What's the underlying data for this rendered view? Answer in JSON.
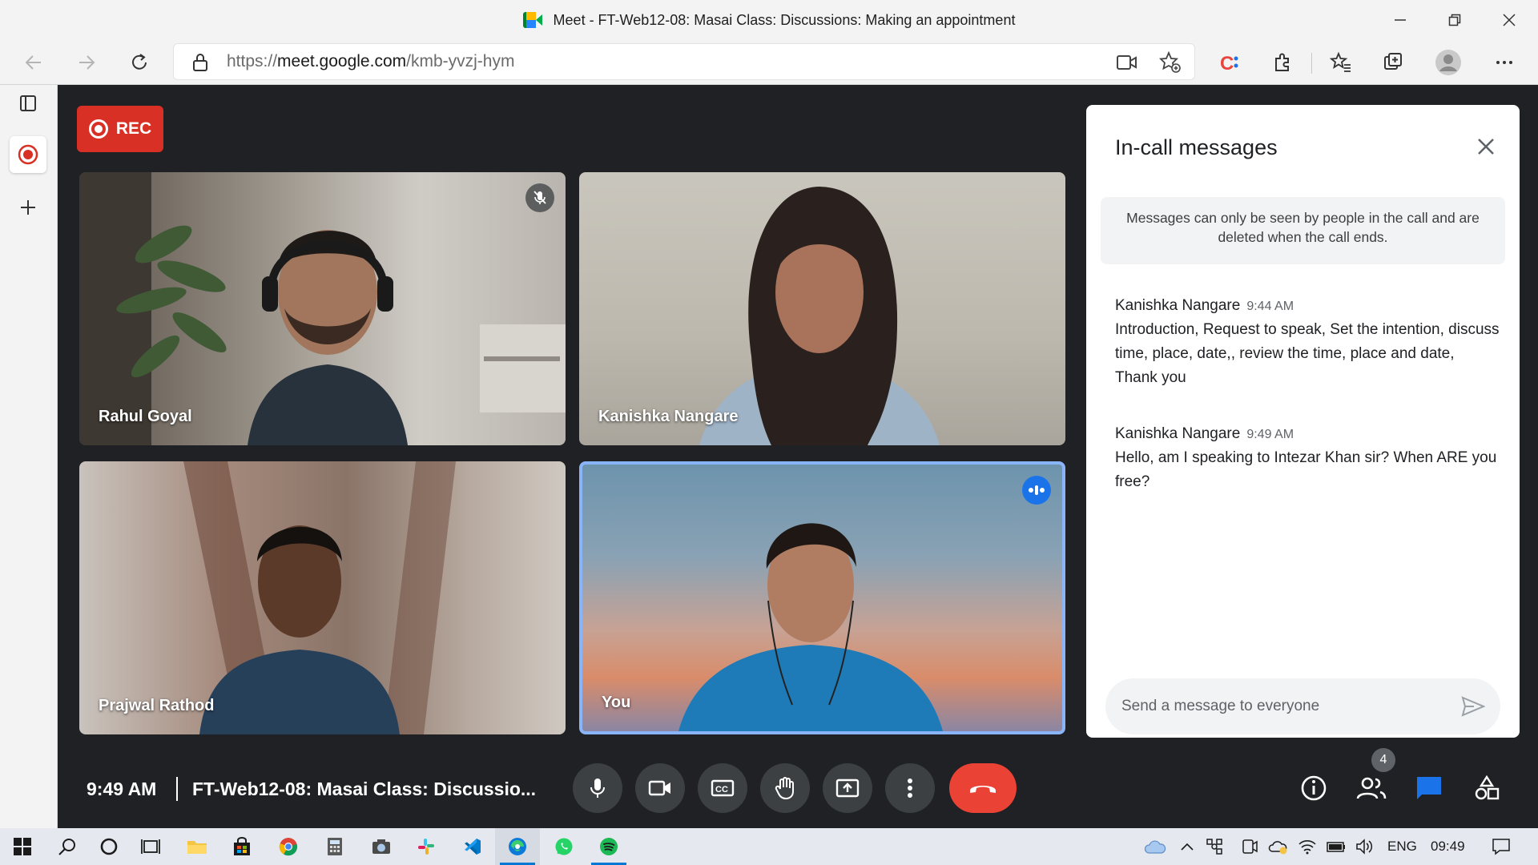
{
  "window": {
    "title": "Meet - FT-Web12-08: Masai Class: Discussions: Making an appointment"
  },
  "browser": {
    "url_prefix": "https://",
    "url_host": "meet.google.com",
    "url_path": "/kmb-yvzj-hym"
  },
  "recording": {
    "label": "REC"
  },
  "participants": [
    {
      "name": "Rahul Goyal",
      "muted": true
    },
    {
      "name": "Kanishka Nangare",
      "muted": false
    },
    {
      "name": "Prajwal Rathod",
      "muted": false
    },
    {
      "name": "You",
      "speaking": true
    }
  ],
  "chat": {
    "title": "In-call messages",
    "notice": "Messages can only be seen by people in the call and are deleted when the call ends.",
    "messages": [
      {
        "sender": "Kanishka Nangare",
        "time": "9:44 AM",
        "text": "Introduction, Request to speak, Set the intention, discuss time, place, date,, review the time, place and date, Thank you"
      },
      {
        "sender": "Kanishka Nangare",
        "time": "9:49 AM",
        "text": "Hello, am I speaking to Intezar Khan sir? When ARE you free?"
      }
    ],
    "input_placeholder": "Send a message to everyone"
  },
  "bottom_bar": {
    "time": "9:49 AM",
    "meeting_title": "FT-Web12-08: Masai Class: Discussio...",
    "participant_count": "4"
  },
  "taskbar": {
    "language": "ENG",
    "clock": "09:49"
  },
  "colors": {
    "meet_bg": "#202124",
    "rec_red": "#d93025",
    "end_call_red": "#ea4335",
    "active_blue": "#8ab4f8",
    "chat_icon_blue": "#1a73e8"
  }
}
